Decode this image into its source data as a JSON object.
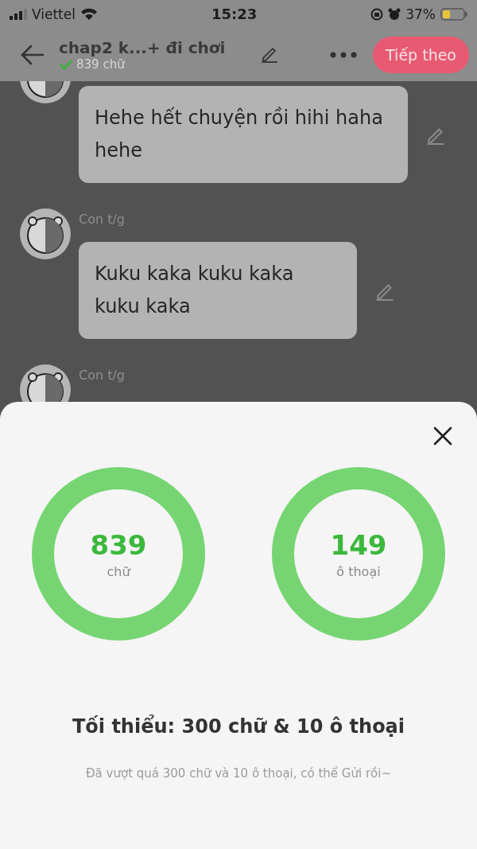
{
  "status_bar": {
    "carrier": "Viettel",
    "time": "15:23",
    "battery": "37%"
  },
  "header": {
    "title": "chap2 k...+ đi chơi",
    "word_count": "839 chữ",
    "next_button": "Tiếp theo"
  },
  "messages": [
    {
      "text": "Hehe hết chuyện rồi hihi haha hehe"
    },
    {
      "author": "Con t/g",
      "text": "Kuku kaka kuku kaka kuku kaka"
    },
    {
      "author": "Con t/g"
    }
  ],
  "sheet": {
    "stats": [
      {
        "value": "839",
        "label": "chữ"
      },
      {
        "value": "149",
        "label": "ô thoại"
      }
    ],
    "requirement": "Tối thiểu: 300 chữ & 10 ô thoại",
    "note": "Đã vượt quá 300 chữ và 10 ô thoại, có thể Gửi rồi~"
  }
}
